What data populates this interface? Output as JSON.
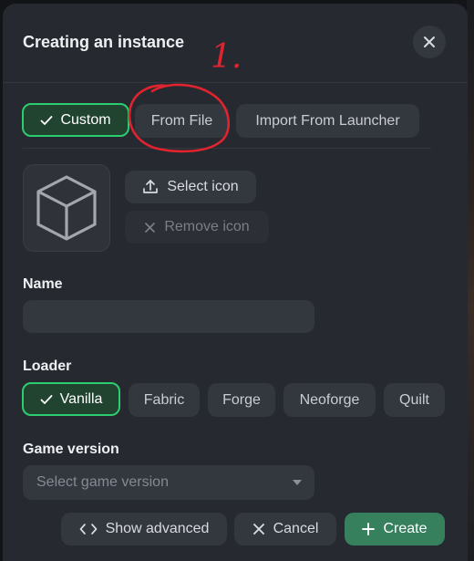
{
  "dialog": {
    "title": "Creating an instance",
    "close_icon": "close-icon"
  },
  "source_tabs": [
    {
      "label": "Custom",
      "selected": true
    },
    {
      "label": "From File",
      "selected": false
    },
    {
      "label": "Import From Launcher",
      "selected": false
    }
  ],
  "icon_section": {
    "placeholder_icon": "cube-icon",
    "select_label": "Select icon",
    "remove_label": "Remove icon"
  },
  "name_field": {
    "label": "Name",
    "value": "",
    "placeholder": ""
  },
  "loader": {
    "label": "Loader",
    "options": [
      {
        "label": "Vanilla",
        "selected": true
      },
      {
        "label": "Fabric",
        "selected": false
      },
      {
        "label": "Forge",
        "selected": false
      },
      {
        "label": "Neoforge",
        "selected": false
      },
      {
        "label": "Quilt",
        "selected": false
      }
    ]
  },
  "game_version": {
    "label": "Game version",
    "placeholder": "Select game version"
  },
  "footer": {
    "show_advanced_label": "Show advanced",
    "cancel_label": "Cancel",
    "create_label": "Create"
  },
  "annotation": {
    "text": "1.",
    "color": "#e0242f"
  },
  "colors": {
    "accent_green": "#2ecc71",
    "create_green": "#37805e",
    "surface": "#26292f",
    "chip": "#33373e"
  }
}
